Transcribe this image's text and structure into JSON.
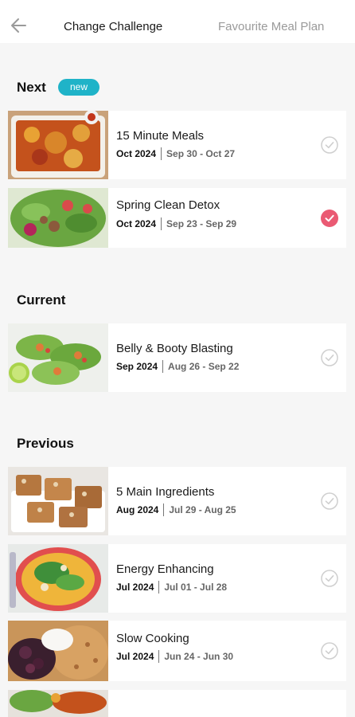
{
  "header": {
    "active_tab": "Change Challenge",
    "inactive_tab": "Favourite Meal Plan"
  },
  "sections": {
    "next": {
      "title": "Next",
      "badge": "new"
    },
    "current": {
      "title": "Current"
    },
    "previous": {
      "title": "Previous"
    }
  },
  "cards": [
    {
      "title": "15 Minute Meals",
      "month": "Oct 2024",
      "range": "Sep 30 - Oct 27",
      "selected": false,
      "image": "baked-pasta-dish"
    },
    {
      "title": "Spring Clean Detox",
      "month": "Oct 2024",
      "range": "Sep 23 - Sep 29",
      "selected": true,
      "image": "green-salad"
    },
    {
      "title": "Belly & Booty Blasting",
      "month": "Sep 2024",
      "range": "Aug 26 - Sep 22",
      "selected": false,
      "image": "lettuce-tacos-with-lime"
    },
    {
      "title": "5 Main Ingredients",
      "month": "Aug 2024",
      "range": "Jul 29 - Aug 25",
      "selected": false,
      "image": "nut-bars"
    },
    {
      "title": "Energy Enhancing",
      "month": "Jul 2024",
      "range": "Jul 01 - Jul 28",
      "selected": false,
      "image": "curry-soup-bowl"
    },
    {
      "title": "Slow Cooking",
      "month": "Jul 2024",
      "range": "Jun 24 - Jun 30",
      "selected": false,
      "image": "berry-granola-yogurt"
    }
  ],
  "colors": {
    "badge": "#1fb3c8",
    "selected_check": "#ea5a73",
    "unselected_check": "#cfcfcf"
  }
}
